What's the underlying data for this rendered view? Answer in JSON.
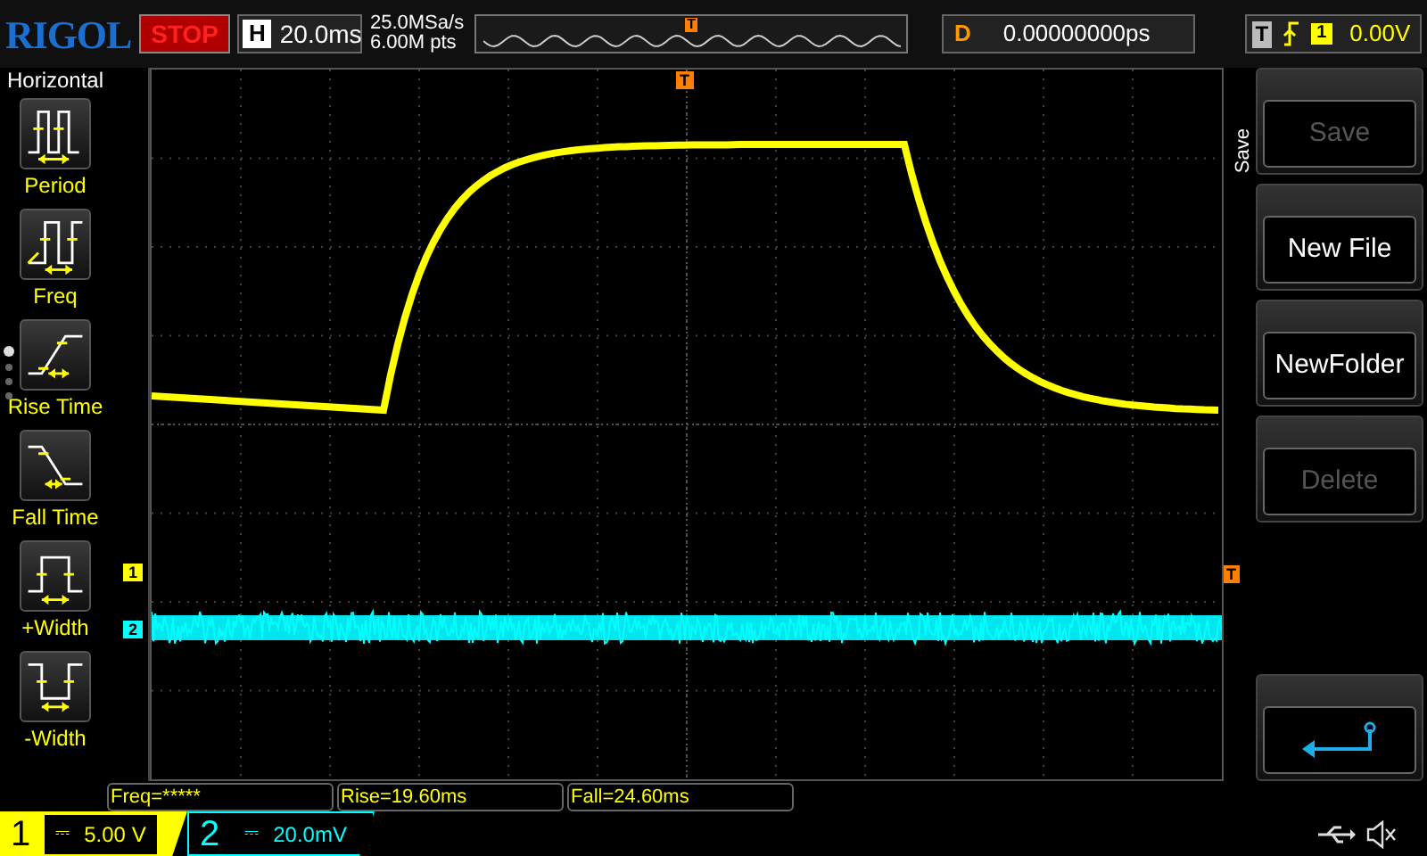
{
  "top_bar": {
    "logo": "RIGOL",
    "run_state": "STOP",
    "horizontal": {
      "label": "H",
      "value": "20.0ms"
    },
    "sample_rate": "25.0MSa/s",
    "memory_depth": "6.00M pts",
    "timeline_marker": "T",
    "delay": {
      "label": "D",
      "value": "0.00000000ps"
    },
    "trigger": {
      "label": "T",
      "source": "1",
      "level": "0.00V"
    }
  },
  "left_menu": {
    "title": "Horizontal",
    "items": [
      {
        "kind": "period",
        "label": "Period"
      },
      {
        "kind": "freq",
        "label": "Freq"
      },
      {
        "kind": "rise",
        "label": "Rise Time"
      },
      {
        "kind": "fall",
        "label": "Fall Time"
      },
      {
        "kind": "pwidth",
        "label": "+Width"
      },
      {
        "kind": "nwidth",
        "label": "-Width"
      }
    ],
    "page_dots": [
      {
        "selected": true
      },
      {
        "selected": false
      },
      {
        "selected": false
      },
      {
        "selected": false
      }
    ]
  },
  "plot": {
    "trigger_marker": "T",
    "trigger_level_marker": "T",
    "channel_markers": [
      {
        "label": "1",
        "color": "#ffff00"
      },
      {
        "label": "2",
        "color": "#00ffff"
      }
    ]
  },
  "measurements": [
    "Freq=*****",
    "Rise=19.60ms",
    "Fall=24.60ms"
  ],
  "right_menu": {
    "title": "Save",
    "buttons": [
      {
        "kind": "text",
        "label": "Save",
        "disabled": true
      },
      {
        "kind": "text",
        "label": "New File",
        "disabled": false
      },
      {
        "kind": "text",
        "label": "NewFolder",
        "disabled": false
      },
      {
        "kind": "text",
        "label": "Delete",
        "disabled": true
      },
      {
        "kind": "back"
      }
    ]
  },
  "channels": [
    {
      "number": "1",
      "coupling": "⎓",
      "scale": "5.00 V",
      "color": "#ffff00",
      "selected": true
    },
    {
      "number": "2",
      "coupling": "⎓",
      "scale": "20.0mV",
      "color": "#00ffff",
      "selected": false
    }
  ]
}
